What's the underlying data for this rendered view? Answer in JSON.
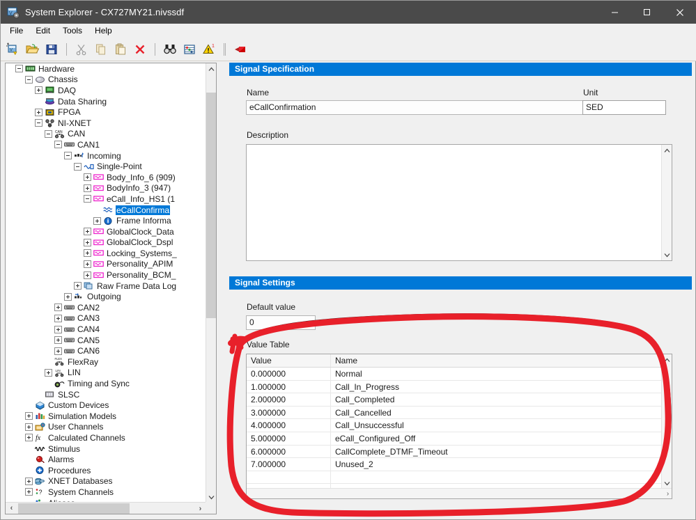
{
  "window": {
    "title": "System Explorer - CX727MY21.nivssdf",
    "app_icon": "system-explorer-icon",
    "minimize_label": "–",
    "maximize_label": "☐",
    "close_label": "✕"
  },
  "menubar": {
    "items": [
      {
        "label": "File"
      },
      {
        "label": "Edit"
      },
      {
        "label": "Tools"
      },
      {
        "label": "Help"
      }
    ]
  },
  "toolbar": {
    "buttons": [
      {
        "name": "new-system-icon",
        "title": "New"
      },
      {
        "name": "open-folder-icon",
        "title": "Open"
      },
      {
        "name": "save-icon",
        "title": "Save"
      },
      {
        "name": "cut-icon",
        "title": "Cut"
      },
      {
        "name": "copy-icon",
        "title": "Copy"
      },
      {
        "name": "paste-icon",
        "title": "Paste"
      },
      {
        "name": "delete-icon",
        "title": "Delete"
      },
      {
        "name": "find-icon",
        "title": "Find"
      },
      {
        "name": "properties-icon",
        "title": "Properties"
      },
      {
        "name": "warnings-icon",
        "title": "Warnings"
      },
      {
        "name": "deploy-icon",
        "title": "Deploy"
      }
    ]
  },
  "tree": {
    "nodes": [
      {
        "label": "Hardware",
        "depth": 2,
        "expander": "minus",
        "icon": "hardware-icon",
        "selected": false
      },
      {
        "label": "Chassis",
        "depth": 3,
        "expander": "minus",
        "icon": "chassis-icon",
        "selected": false
      },
      {
        "label": "DAQ",
        "depth": 4,
        "expander": "plus",
        "icon": "daq-icon",
        "selected": false
      },
      {
        "label": "Data Sharing",
        "depth": 4,
        "expander": "none",
        "icon": "data-sharing-icon",
        "selected": false
      },
      {
        "label": "FPGA",
        "depth": 4,
        "expander": "plus",
        "icon": "fpga-icon",
        "selected": false
      },
      {
        "label": "NI-XNET",
        "depth": 4,
        "expander": "minus",
        "icon": "ni-xnet-icon",
        "selected": false
      },
      {
        "label": "CAN",
        "depth": 5,
        "expander": "minus",
        "icon": "can-icon",
        "selected": false
      },
      {
        "label": "CAN1",
        "depth": 6,
        "expander": "minus",
        "icon": "port-icon",
        "selected": false
      },
      {
        "label": "Incoming",
        "depth": 7,
        "expander": "minus",
        "icon": "incoming-icon",
        "selected": false
      },
      {
        "label": "Single-Point",
        "depth": 8,
        "expander": "minus",
        "icon": "single-point-icon",
        "selected": false
      },
      {
        "label": "Body_Info_6 (909)",
        "depth": 9,
        "expander": "plus",
        "icon": "frame-icon",
        "selected": false
      },
      {
        "label": "BodyInfo_3 (947)",
        "depth": 9,
        "expander": "plus",
        "icon": "frame-icon",
        "selected": false
      },
      {
        "label": "eCall_Info_HS1 (1",
        "depth": 9,
        "expander": "minus",
        "icon": "frame-icon",
        "selected": false
      },
      {
        "label": "eCallConfirma",
        "depth": 10,
        "expander": "none",
        "icon": "signal-icon",
        "selected": true
      },
      {
        "label": "Frame Informa",
        "depth": 10,
        "expander": "plus",
        "icon": "info-icon",
        "selected": false
      },
      {
        "label": "GlobalClock_Data",
        "depth": 9,
        "expander": "plus",
        "icon": "frame-icon",
        "selected": false
      },
      {
        "label": "GlobalClock_Dspl",
        "depth": 9,
        "expander": "plus",
        "icon": "frame-icon",
        "selected": false
      },
      {
        "label": "Locking_Systems_",
        "depth": 9,
        "expander": "plus",
        "icon": "frame-icon",
        "selected": false
      },
      {
        "label": "Personality_APIM",
        "depth": 9,
        "expander": "plus",
        "icon": "frame-icon",
        "selected": false
      },
      {
        "label": "Personality_BCM_",
        "depth": 9,
        "expander": "plus",
        "icon": "frame-icon",
        "selected": false
      },
      {
        "label": "Raw Frame Data Log",
        "depth": 8,
        "expander": "plus",
        "icon": "raw-frame-icon",
        "selected": false
      },
      {
        "label": "Outgoing",
        "depth": 7,
        "expander": "plus",
        "icon": "outgoing-icon",
        "selected": false
      },
      {
        "label": "CAN2",
        "depth": 6,
        "expander": "plus",
        "icon": "port-icon",
        "selected": false
      },
      {
        "label": "CAN3",
        "depth": 6,
        "expander": "plus",
        "icon": "port-icon",
        "selected": false
      },
      {
        "label": "CAN4",
        "depth": 6,
        "expander": "plus",
        "icon": "port-icon",
        "selected": false
      },
      {
        "label": "CAN5",
        "depth": 6,
        "expander": "plus",
        "icon": "port-icon",
        "selected": false
      },
      {
        "label": "CAN6",
        "depth": 6,
        "expander": "plus",
        "icon": "port-icon",
        "selected": false
      },
      {
        "label": "FlexRay",
        "depth": 5,
        "expander": "none",
        "icon": "flexray-icon",
        "selected": false
      },
      {
        "label": "LIN",
        "depth": 5,
        "expander": "plus",
        "icon": "lin-icon",
        "selected": false
      },
      {
        "label": "Timing and Sync",
        "depth": 5,
        "expander": "none",
        "icon": "timing-sync-icon",
        "selected": false
      },
      {
        "label": "SLSC",
        "depth": 4,
        "expander": "none",
        "icon": "slsc-icon",
        "selected": false
      },
      {
        "label": "Custom Devices",
        "depth": 3,
        "expander": "none",
        "icon": "custom-devices-icon",
        "selected": false
      },
      {
        "label": "Simulation Models",
        "depth": 3,
        "expander": "plus",
        "icon": "simulation-models-icon",
        "selected": false
      },
      {
        "label": "User Channels",
        "depth": 3,
        "expander": "plus",
        "icon": "user-channels-icon",
        "selected": false
      },
      {
        "label": "Calculated Channels",
        "depth": 3,
        "expander": "plus",
        "icon": "calculated-channels-icon",
        "selected": false
      },
      {
        "label": "Stimulus",
        "depth": 3,
        "expander": "none",
        "icon": "stimulus-icon",
        "selected": false
      },
      {
        "label": "Alarms",
        "depth": 3,
        "expander": "none",
        "icon": "alarms-icon",
        "selected": false
      },
      {
        "label": "Procedures",
        "depth": 3,
        "expander": "none",
        "icon": "procedures-icon",
        "selected": false
      },
      {
        "label": "XNET Databases",
        "depth": 3,
        "expander": "plus",
        "icon": "xnet-databases-icon",
        "selected": false
      },
      {
        "label": "System Channels",
        "depth": 3,
        "expander": "plus",
        "icon": "system-channels-icon",
        "selected": false
      },
      {
        "label": "Aliases",
        "depth": 3,
        "expander": "none",
        "icon": "aliases-icon",
        "selected": false
      }
    ]
  },
  "signal_specification": {
    "header": "Signal Specification",
    "name_label": "Name",
    "name_value": "eCallConfirmation",
    "unit_label": "Unit",
    "unit_value": "SED",
    "description_label": "Description",
    "description_value": ""
  },
  "signal_settings": {
    "header": "Signal Settings",
    "default_value_label": "Default value",
    "default_value": "0",
    "value_table_label": "Value Table",
    "columns": [
      "Value",
      "Name"
    ],
    "rows": [
      {
        "value": "0.000000",
        "name": "Normal"
      },
      {
        "value": "1.000000",
        "name": "Call_In_Progress"
      },
      {
        "value": "2.000000",
        "name": "Call_Completed"
      },
      {
        "value": "3.000000",
        "name": "Call_Cancelled"
      },
      {
        "value": "4.000000",
        "name": "Call_Unsuccessful"
      },
      {
        "value": "5.000000",
        "name": "eCall_Configured_Off"
      },
      {
        "value": "6.000000",
        "name": "CallComplete_DTMF_Timeout"
      },
      {
        "value": "7.000000",
        "name": "Unused_2"
      },
      {
        "value": "",
        "name": ""
      },
      {
        "value": "",
        "name": ""
      },
      {
        "value": "",
        "name": ""
      }
    ]
  },
  "annotation": {
    "name": "red-ellipse-highlight",
    "color": "#e8202a",
    "shape": "hand-drawn-oval"
  },
  "colors": {
    "accent": "#0078d7",
    "titlebar": "#4a4a4a",
    "panel_bg": "#f0f0f0",
    "annotation_red": "#e8202a"
  }
}
